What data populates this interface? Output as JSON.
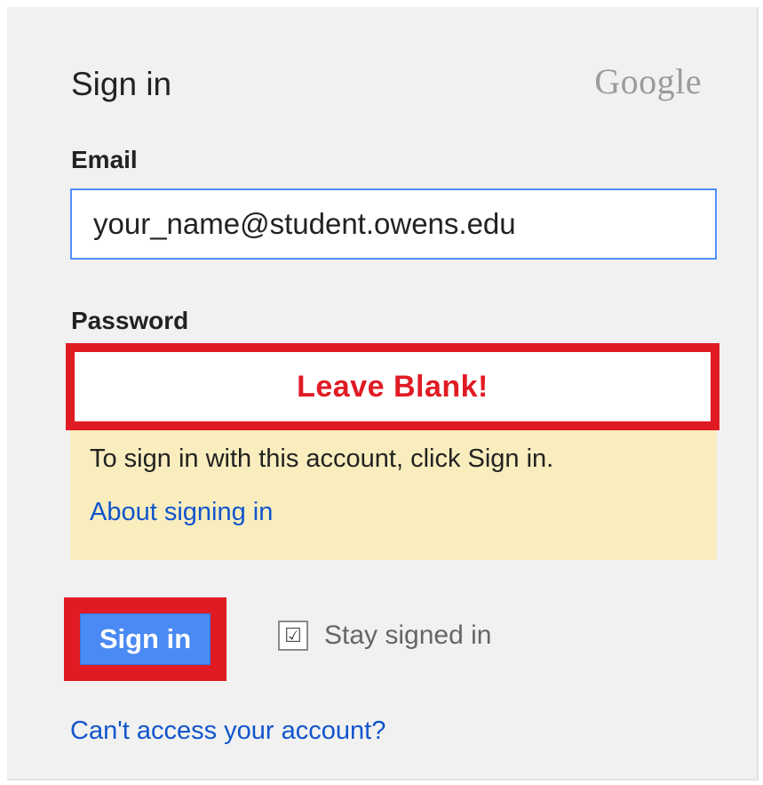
{
  "header": {
    "title": "Sign in",
    "logo_text": "Google"
  },
  "email": {
    "label": "Email",
    "value": "your_name@student.owens.edu"
  },
  "password": {
    "label": "Password",
    "annotation": "Leave Blank!"
  },
  "notice": {
    "text": "To sign in with this account, click Sign in.",
    "link_label": "About signing in"
  },
  "actions": {
    "signin_label": "Sign in",
    "stay_signed_in_label": "Stay signed in",
    "stay_signed_in_checked": true,
    "checkbox_glyph": "☑"
  },
  "footer": {
    "cant_access_label": "Can't access your account?"
  },
  "colors": {
    "accent_blue": "#4a8af4",
    "annotation_red": "#e01b24",
    "notice_bg": "#f9edbe",
    "link": "#1155cc"
  }
}
